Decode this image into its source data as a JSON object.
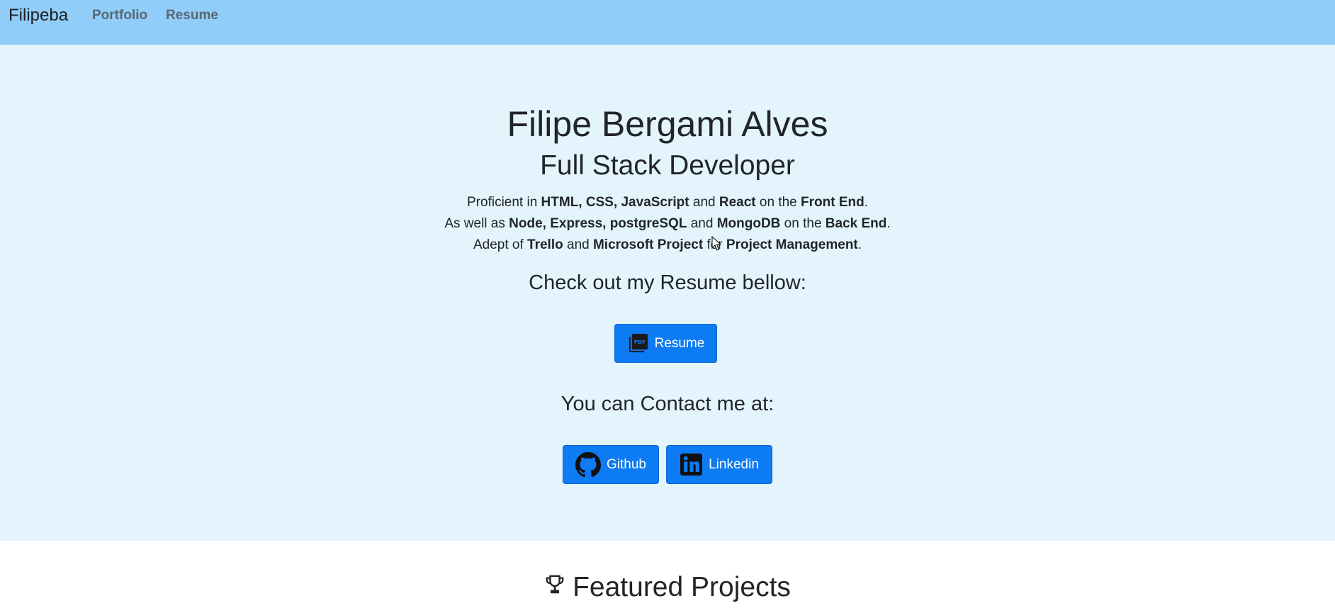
{
  "navbar": {
    "brand": "Filipeba",
    "links": [
      {
        "label": "Portfolio"
      },
      {
        "label": "Resume"
      }
    ],
    "background": "#90cdf9"
  },
  "hero": {
    "background": "#e4f4fd",
    "name": "Filipe Bergami Alves",
    "role": "Full Stack Developer",
    "line1": {
      "t1": "Proficient in ",
      "b1": "HTML, CSS, JavaScript",
      "t2": " and ",
      "b2": "React",
      "t3": " on the ",
      "b3": "Front End",
      "t4": "."
    },
    "line2": {
      "t1": "As well as ",
      "b1": "Node, Express, postgreSQL",
      "t2": " and ",
      "b2": "MongoDB",
      "t3": " on the ",
      "b3": "Back End",
      "t4": "."
    },
    "line3": {
      "t1": "Adept of ",
      "b1": "Trello",
      "t2": " and ",
      "b2": "Microsoft Project",
      "t3": " for ",
      "b3": "Project Management",
      "t4": "."
    },
    "resume_heading": "Check out my Resume bellow:",
    "resume_button": {
      "label": "Resume",
      "icon": "pdf-icon"
    },
    "contact_heading": "You can Contact me at:",
    "github_button": {
      "label": "Github",
      "icon": "github-icon"
    },
    "linkedin_button": {
      "label": "Linkedin",
      "icon": "linkedin-icon"
    },
    "button_color": "#0d7bf3"
  },
  "featured": {
    "title": "Featured Projects",
    "icon": "trophy-icon"
  }
}
